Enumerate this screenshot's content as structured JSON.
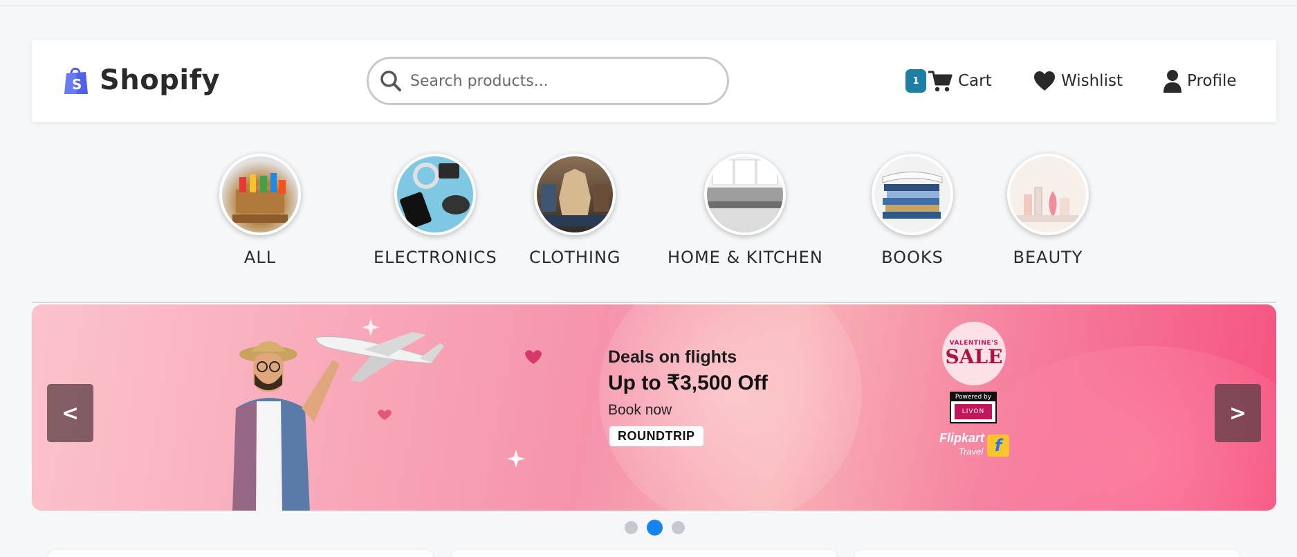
{
  "header": {
    "logo_text": "Shopify",
    "search_placeholder": "Search products...",
    "cart_count": "1",
    "cart_label": "Cart",
    "wishlist_label": "Wishlist",
    "profile_label": "Profile"
  },
  "categories": [
    {
      "label": "ALL",
      "icon": "groceries-image"
    },
    {
      "label": "ELECTRONICS",
      "icon": "electronics-image"
    },
    {
      "label": "CLOTHING",
      "icon": "clothing-image"
    },
    {
      "label": "HOME & KITCHEN",
      "icon": "kitchen-image"
    },
    {
      "label": "BOOKS",
      "icon": "books-image"
    },
    {
      "label": "BEAUTY",
      "icon": "beauty-image"
    }
  ],
  "banner": {
    "title": "Deals on flights",
    "headline": "Up to ₹3,500 Off",
    "subtext": "Book now",
    "tag": "ROUNDTRIP",
    "badge_small": "VALENTINE'S",
    "badge_big": "SALE",
    "powered_by": "Powered by",
    "partner": "LIVON",
    "brand": "Flipkart",
    "brand_sub": "Travel",
    "prev_label": "<",
    "next_label": ">"
  },
  "carousel": {
    "slide_count": 3,
    "active_index": 1
  },
  "colors": {
    "accent": "#1584ee",
    "cart_badge": "#1d7fa3",
    "logo": "#5b6bf0"
  }
}
